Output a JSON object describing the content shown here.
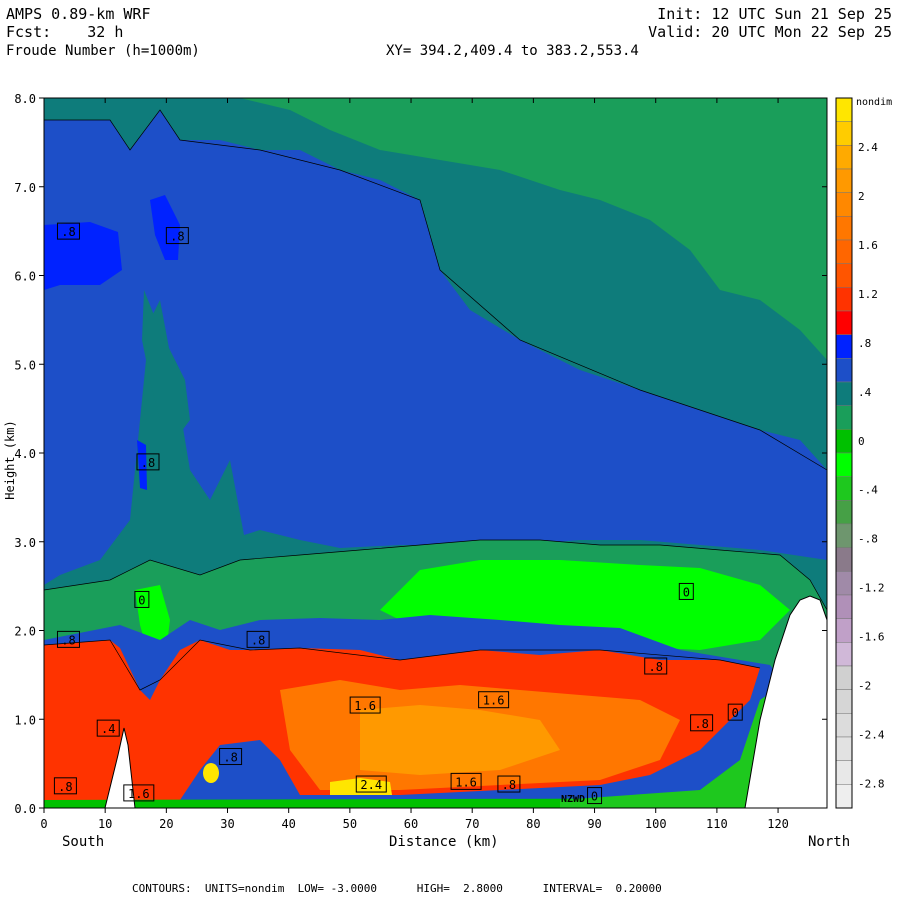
{
  "header": {
    "line1_left": "AMPS 0.89-km WRF",
    "line2_left": "Fcst:    32 h",
    "line3_left": "Froude Number (h=1000m)",
    "line1_right": "Init: 12 UTC Sun 21 Sep 25",
    "line2_right": "Valid: 20 UTC Mon 22 Sep 25",
    "xy_text": "XY= 394.2,409.4 to 383.2,553.4"
  },
  "footer": {
    "contours_text": "CONTOURS:  UNITS=nondim  LOW= -3.0000      HIGH=  2.8000      INTERVAL=  0.20000"
  },
  "chart_data": {
    "type": "heatmap",
    "title": "Froude Number (h=1000m)",
    "xlabel": "Distance (km)",
    "ylabel": "Height (km)",
    "x_left_label": "South",
    "x_right_label": "North",
    "xlim": [
      0,
      128
    ],
    "ylim": [
      0,
      8
    ],
    "xticks": [
      0,
      10,
      20,
      30,
      40,
      50,
      60,
      70,
      80,
      90,
      100,
      110,
      120
    ],
    "yticks": [
      0.0,
      1.0,
      2.0,
      3.0,
      4.0,
      5.0,
      6.0,
      7.0,
      8.0
    ],
    "ytick_labels": [
      "0.0",
      "1.0",
      "2.0",
      "3.0",
      "4.0",
      "5.0",
      "6.0",
      "7.0",
      "8.0"
    ],
    "colorbar": {
      "unit": "nondim",
      "labels": [
        "2.4",
        "2",
        "1.6",
        "1.2",
        ".8",
        ".4",
        "0",
        "-.4",
        "-.8",
        "-1.2",
        "-1.6",
        "-2",
        "-2.4",
        "-2.8"
      ],
      "label_values": [
        2.4,
        2.0,
        1.6,
        1.2,
        0.8,
        0.4,
        0.0,
        -0.4,
        -0.8,
        -1.2,
        -1.6,
        -2.0,
        -2.4,
        -2.8
      ],
      "levels": [
        2.8,
        2.6,
        2.4,
        2.2,
        2.0,
        1.8,
        1.6,
        1.4,
        1.2,
        1.0,
        0.8,
        0.6,
        0.4,
        0.2,
        0.0,
        -0.2,
        -0.4,
        -0.6,
        -0.8,
        -1.0,
        -1.2,
        -1.4,
        -1.6,
        -1.8,
        -2.0,
        -2.2,
        -2.4,
        -2.6,
        -2.8,
        -3.0
      ],
      "colors": [
        "#ffe600",
        "#ffcc00",
        "#ffaa00",
        "#ff9900",
        "#ff8800",
        "#ff7700",
        "#ff6600",
        "#ff5500",
        "#ff3300",
        "#ff0000",
        "#0022ff",
        "#1d4fc8",
        "#0e7c7b",
        "#1a9e5a",
        "#00c000",
        "#00ff00",
        "#1ec81e",
        "#46a046",
        "#6e966e",
        "#8a7a8a",
        "#a08aa8",
        "#b090b8",
        "#c0a0c8",
        "#d0b8d8",
        "#d0d0d0",
        "#d6d6d6",
        "#dcdcdc",
        "#e2e2e2",
        "#e8e8e8",
        "#eeeeee"
      ]
    },
    "contour_labels": [
      {
        "text": ".8",
        "x": 4,
        "y": 6.5
      },
      {
        "text": ".8",
        "x": 21.8,
        "y": 6.45
      },
      {
        "text": ".8",
        "x": 17,
        "y": 3.9
      },
      {
        "text": "0",
        "x": 16,
        "y": 2.35
      },
      {
        "text": ".8",
        "x": 4,
        "y": 1.9
      },
      {
        "text": ".8",
        "x": 35,
        "y": 1.9
      },
      {
        "text": ".4",
        "x": 10.5,
        "y": 0.9
      },
      {
        "text": ".8",
        "x": 3.5,
        "y": 0.25
      },
      {
        "text": "1.6",
        "x": 15.5,
        "y": 0.17
      },
      {
        "text": ".8",
        "x": 30.5,
        "y": 0.58
      },
      {
        "text": "1.6",
        "x": 52.5,
        "y": 1.16
      },
      {
        "text": "1.6",
        "x": 73.5,
        "y": 1.22
      },
      {
        "text": "2.4",
        "x": 53.5,
        "y": 0.27
      },
      {
        "text": "1.6",
        "x": 69,
        "y": 0.3
      },
      {
        "text": ".8",
        "x": 76,
        "y": 0.27
      },
      {
        "text": "0",
        "x": 105,
        "y": 2.44
      },
      {
        "text": ".8",
        "x": 100,
        "y": 1.6
      },
      {
        "text": ".8",
        "x": 107.5,
        "y": 0.96
      },
      {
        "text": "0",
        "x": 113,
        "y": 1.08
      },
      {
        "text": "0",
        "x": 90,
        "y": 0.14
      }
    ],
    "station_label": "NZWD"
  }
}
